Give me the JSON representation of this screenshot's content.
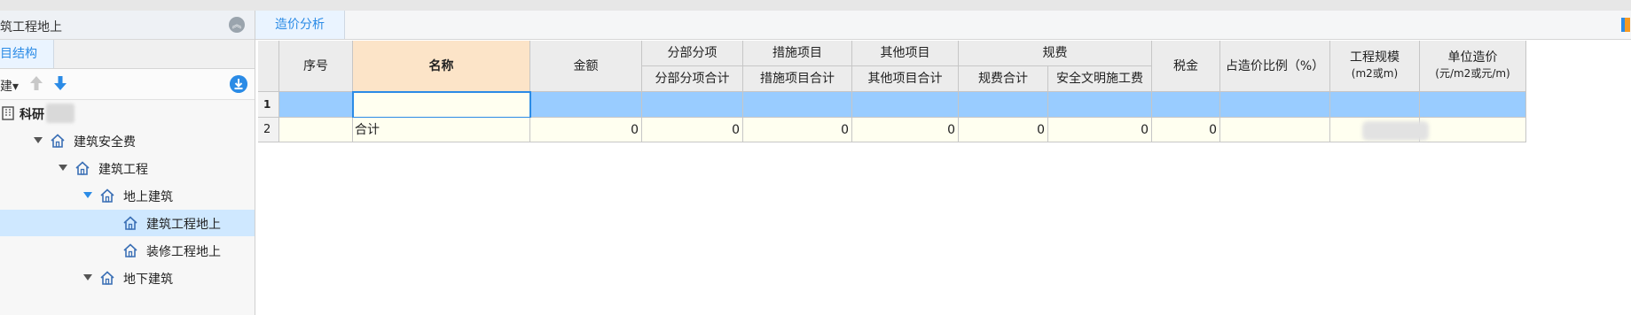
{
  "left_panel": {
    "title": "筑工程地上",
    "tab_label": "目结构",
    "toolbar_new_label": "建▾",
    "tree": [
      {
        "label": "科研",
        "level": 0,
        "icon": "building-icon",
        "arrow": "none",
        "blurred": true
      },
      {
        "label": "建筑安全费",
        "level": 1,
        "icon": "house-icon",
        "arrow": "down"
      },
      {
        "label": "建筑工程",
        "level": 2,
        "icon": "house-icon",
        "arrow": "down"
      },
      {
        "label": "地上建筑",
        "level": 3,
        "icon": "house-icon",
        "arrow": "down-blue"
      },
      {
        "label": "建筑工程地上",
        "level": 4,
        "icon": "house-icon",
        "arrow": "none",
        "selected": true
      },
      {
        "label": "装修工程地上",
        "level": 4,
        "icon": "house-icon",
        "arrow": "none"
      },
      {
        "label": "地下建筑",
        "level": 3,
        "icon": "house-icon",
        "arrow": "down"
      }
    ]
  },
  "right_panel": {
    "tab_label": "造价分析",
    "headers": {
      "seq": "序号",
      "name": "名称",
      "amount": "金额",
      "fbfx": "分部分项",
      "fbfx_total": "分部分项合计",
      "csxm": "措施项目",
      "csxm_total": "措施项目合计",
      "qtxm": "其他项目",
      "qtxm_total": "其他项目合计",
      "gf": "规费",
      "gf_total": "规费合计",
      "aqwm": "安全文明施工费",
      "tax": "税金",
      "ratio": "占造价比例（%）",
      "scale": "工程规模",
      "scale_unit": "(m2或m)",
      "unit_price": "单位造价",
      "unit_price_unit": "(元/m2或元/m)"
    },
    "rows": [
      {
        "row_no": "1",
        "seq": "",
        "name": "",
        "amount": "",
        "fbfx_total": "",
        "csxm_total": "",
        "qtxm_total": "",
        "gf_total": "",
        "aqwm": "",
        "tax": "",
        "ratio": "",
        "scale": "",
        "unit_price": ""
      },
      {
        "row_no": "2",
        "seq": "",
        "name": "合计",
        "amount": "0",
        "fbfx_total": "0",
        "csxm_total": "0",
        "qtxm_total": "0",
        "gf_total": "0",
        "aqwm": "0",
        "tax": "0",
        "ratio": "",
        "scale": "",
        "unit_price": ""
      }
    ]
  }
}
